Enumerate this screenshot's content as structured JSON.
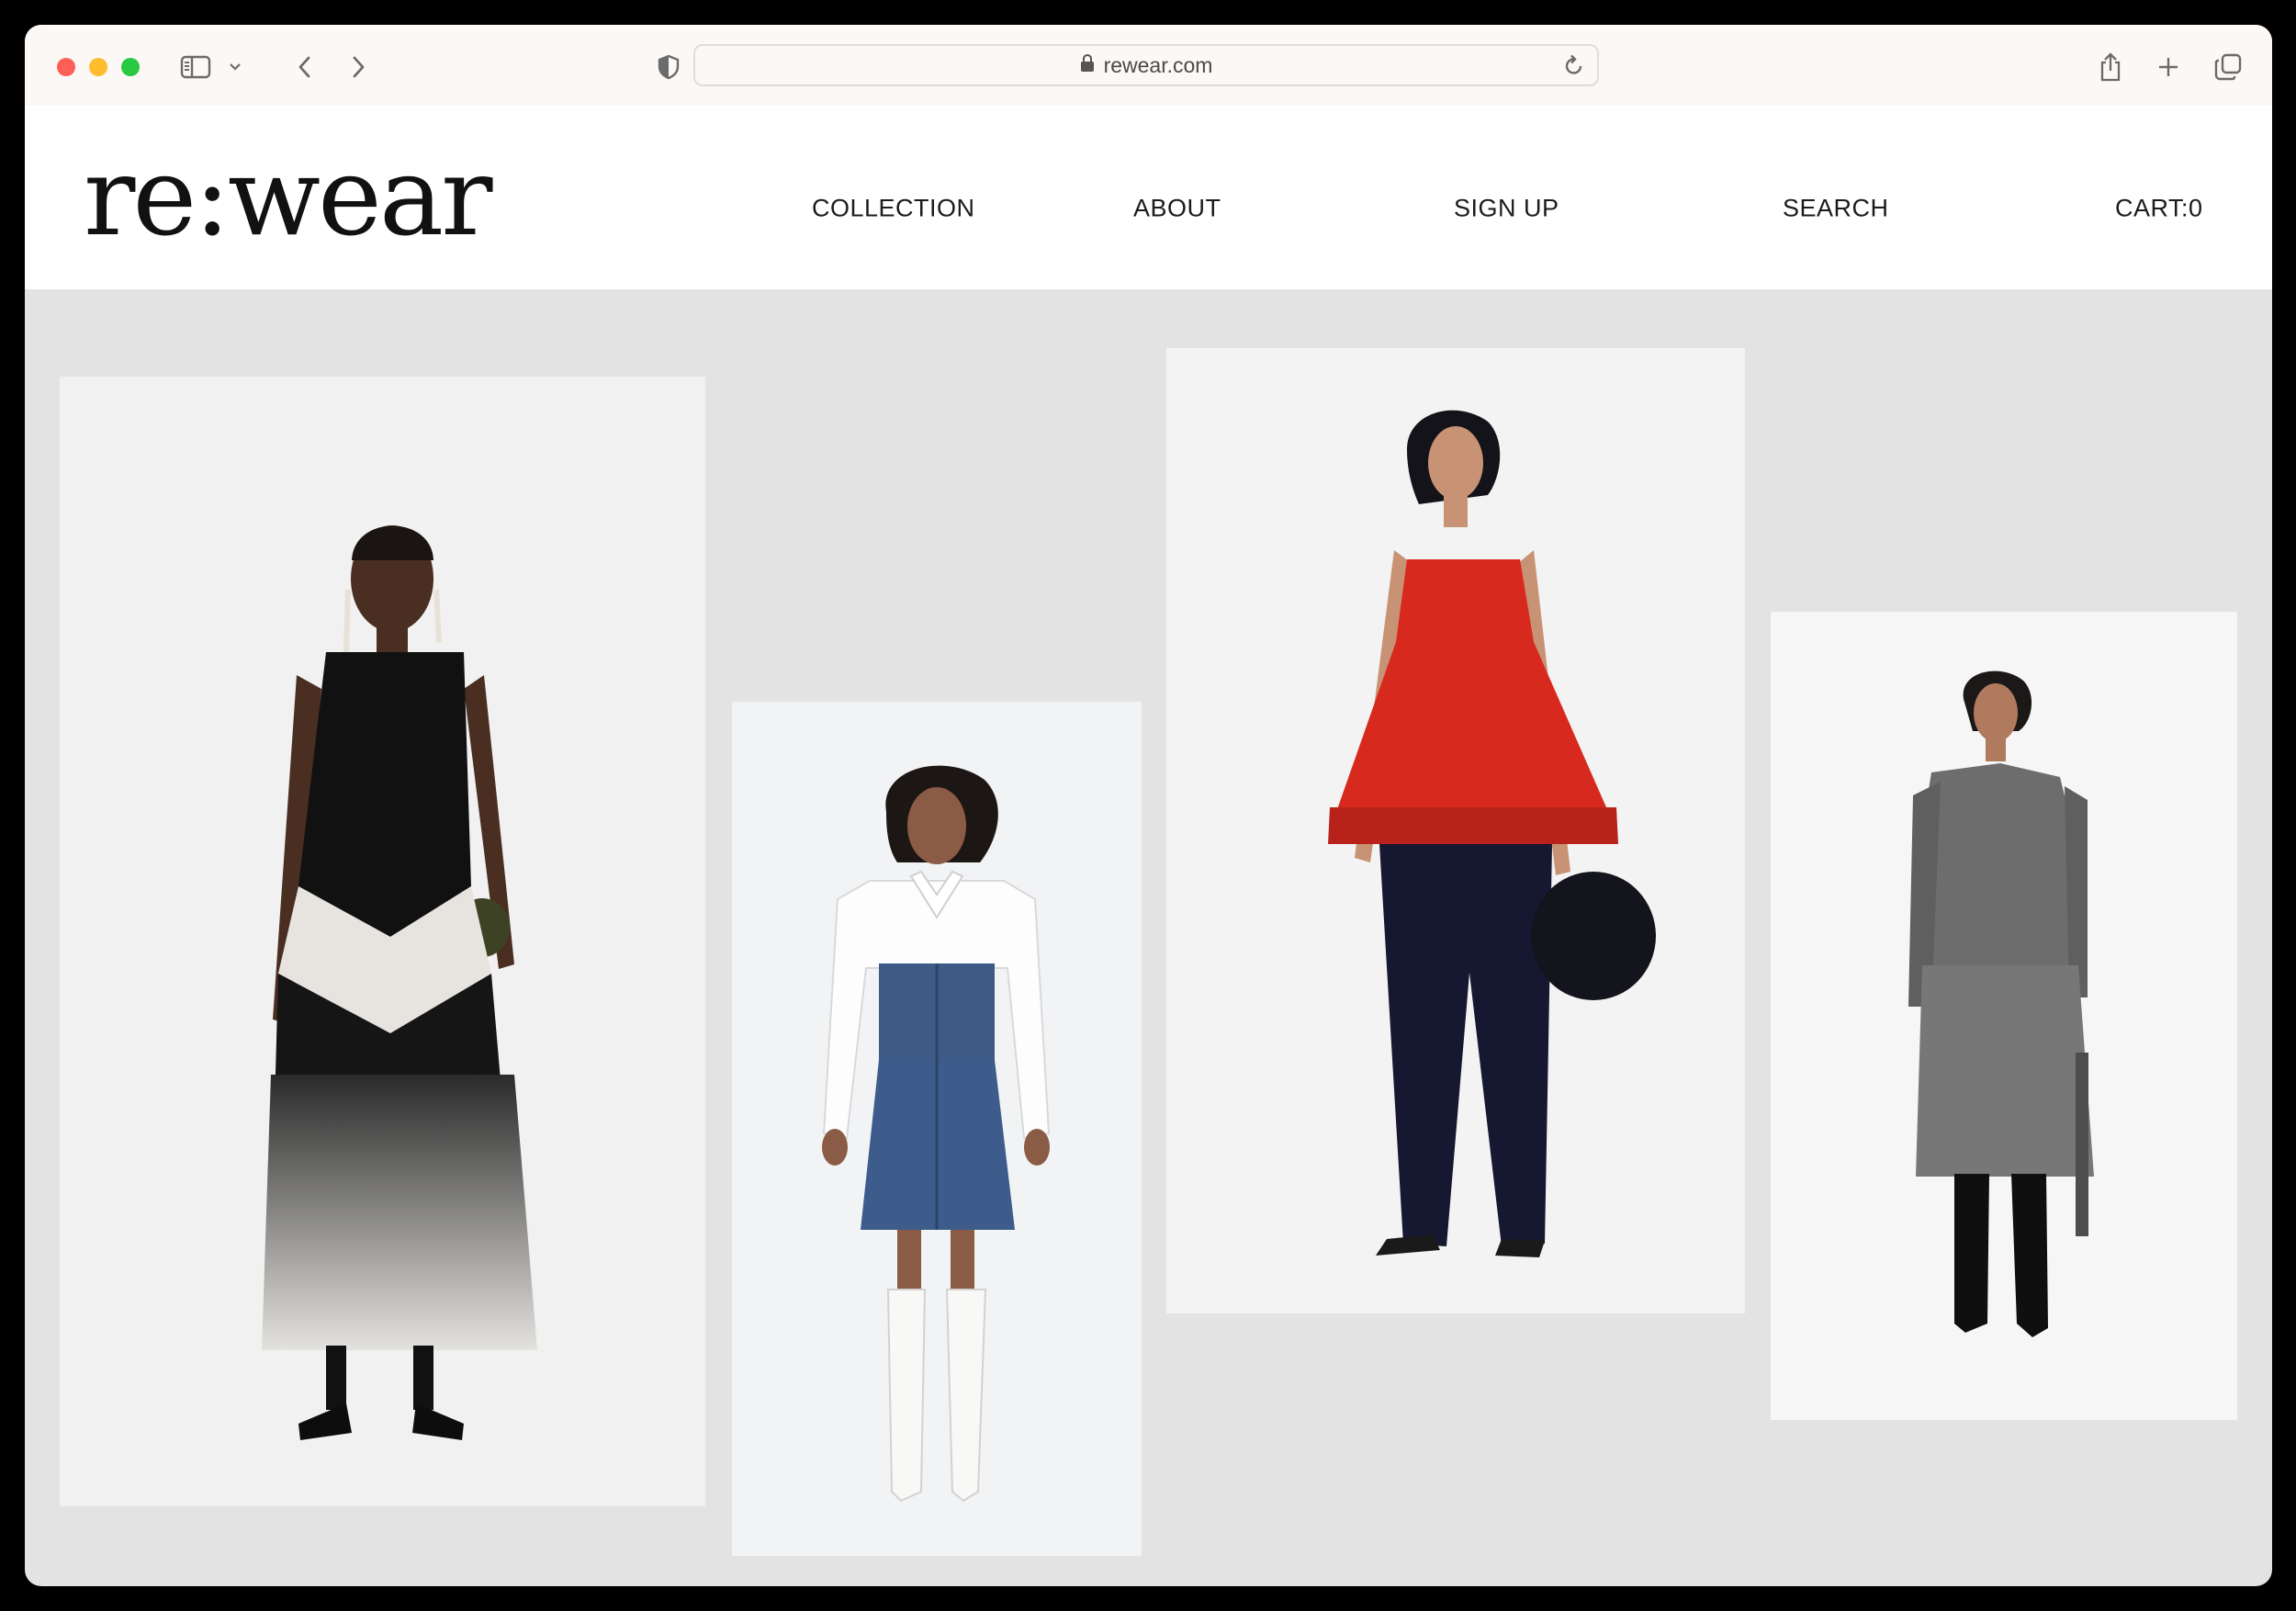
{
  "browser": {
    "url": "rewear.com"
  },
  "site": {
    "logo": "re:wear",
    "nav": {
      "collection": "COLLECTION",
      "about": "ABOUT",
      "signup": "SIGN UP",
      "search": "SEARCH",
      "cart": "CART:0"
    }
  },
  "gallery": {
    "items": [
      {
        "name": "halter-maxi-dress-look",
        "icon": "model-photo"
      },
      {
        "name": "denim-shirt-dress-look",
        "icon": "model-photo"
      },
      {
        "name": "red-taffeta-top-look",
        "icon": "model-photo"
      },
      {
        "name": "grey-wool-suit-look",
        "icon": "model-photo"
      }
    ]
  },
  "colors": {
    "chrome_bg": "#fcf8f5",
    "page_bg": "#e3e3e3",
    "header_bg": "#ffffff",
    "text": "#1b1b1b"
  }
}
